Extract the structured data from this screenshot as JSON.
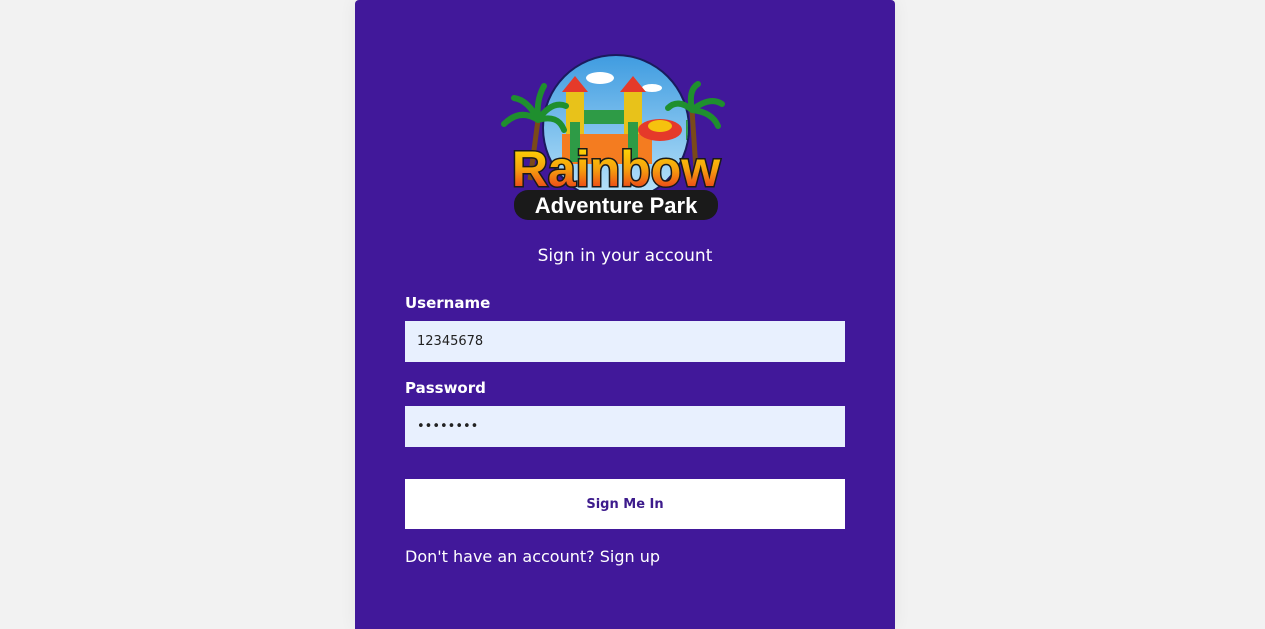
{
  "logo": {
    "title": "Rainbow",
    "subtitle": "Adventure Park"
  },
  "form": {
    "heading": "Sign in your account",
    "username_label": "Username",
    "username_value": "12345678",
    "password_label": "Password",
    "password_value": "12345678",
    "submit_label": "Sign Me In",
    "signup_prompt": "Don't have an account?",
    "signup_link": "Sign up"
  },
  "colors": {
    "card": "#41189a",
    "background": "#f2f2f2",
    "input": "#e8f0fe",
    "button_text": "#3d1b8c"
  }
}
